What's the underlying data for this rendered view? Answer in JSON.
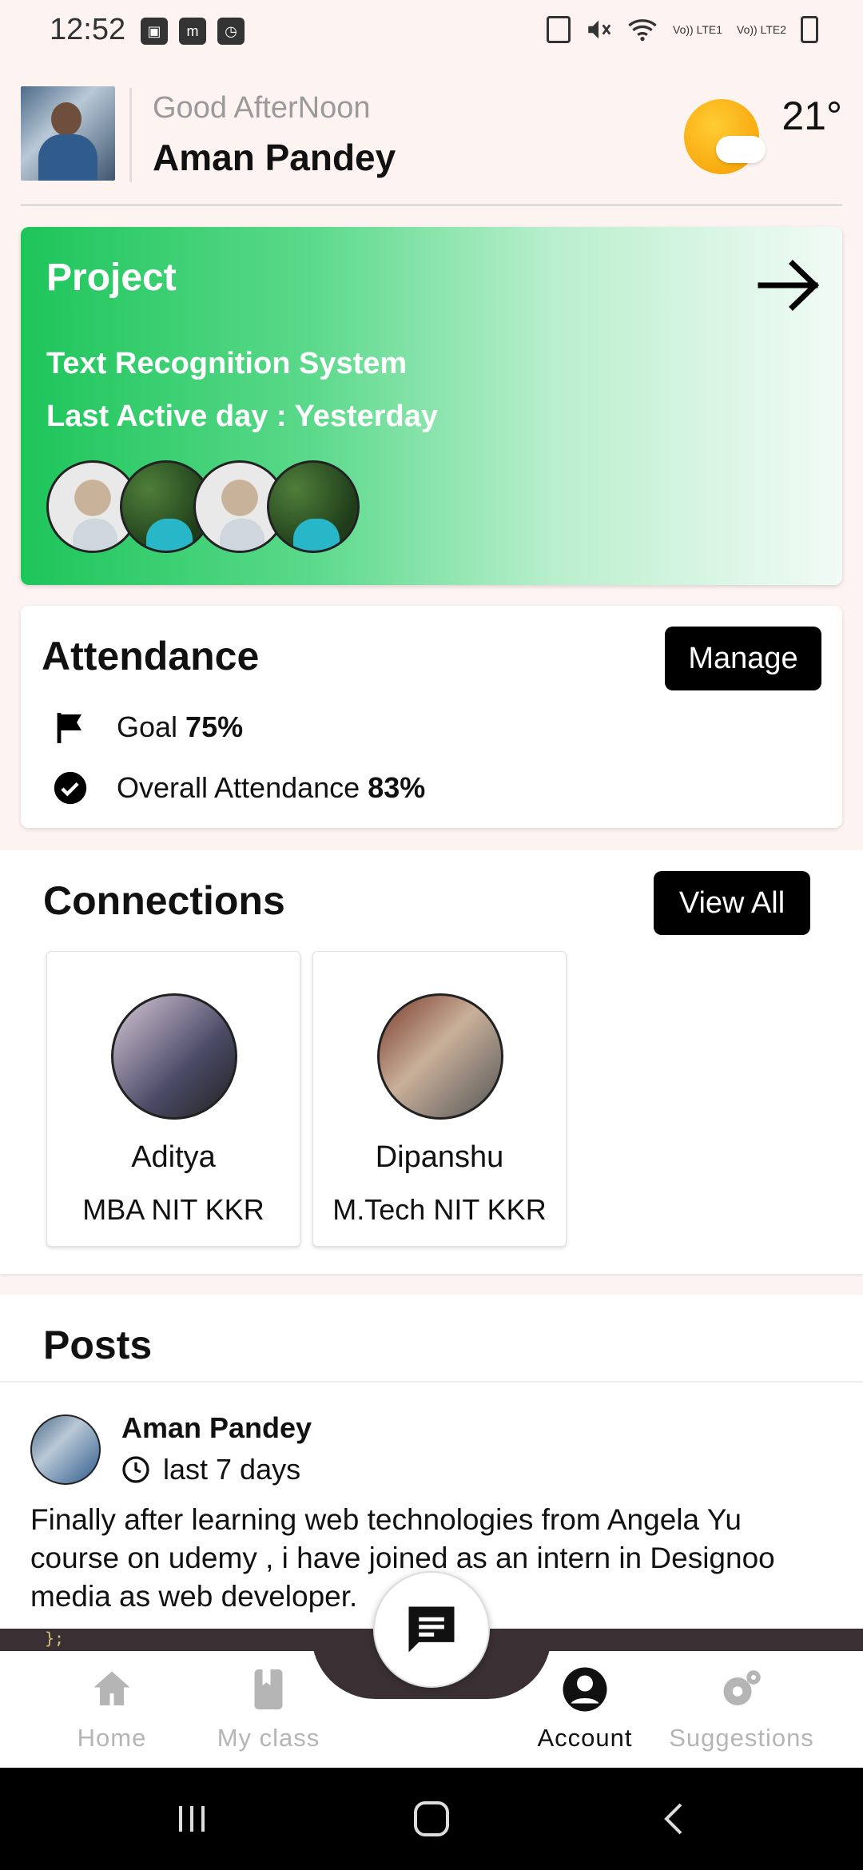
{
  "status_bar": {
    "time": "12:52",
    "left_icons": [
      "image-icon",
      "my-app-icon",
      "clock-app-icon"
    ],
    "right_icons": [
      "nfc-icon",
      "mute-icon",
      "wifi-icon",
      "lte1-signal-icon",
      "lte2-signal-icon",
      "battery-icon"
    ],
    "lte1_label": "Vo)) LTE1",
    "lte2_label": "Vo)) LTE2"
  },
  "header": {
    "greeting": "Good AfterNoon",
    "user_name": "Aman Pandey",
    "temperature": "21°",
    "weather_icon": "sun-cloud-icon"
  },
  "project": {
    "title": "Project",
    "name": "Text Recognition System",
    "last_active": "Last Active day : Yesterday",
    "member_count": 4
  },
  "attendance": {
    "title": "Attendance",
    "manage_label": "Manage",
    "goal_label": "Goal",
    "goal_value": "75%",
    "overall_label": "Overall Attendance",
    "overall_value": "83%"
  },
  "connections": {
    "title": "Connections",
    "view_all_label": "View All",
    "items": [
      {
        "name": "Aditya",
        "subtitle": "MBA NIT KKR"
      },
      {
        "name": "Dipanshu",
        "subtitle": "M.Tech NIT KKR"
      }
    ]
  },
  "posts": {
    "title": "Posts",
    "items": [
      {
        "author": "Aman Pandey",
        "time": "last 7 days",
        "text": "Finally after learning web technologies from Angela Yu course on udemy , i have joined as an intern in Designoo media as web developer.",
        "image_snippet": "};"
      }
    ]
  },
  "bottom_nav": {
    "items": [
      {
        "label": "Home",
        "icon": "home-icon",
        "active": false
      },
      {
        "label": "My class",
        "icon": "book-icon",
        "active": false
      },
      {
        "label": "Account",
        "icon": "account-icon",
        "active": true
      },
      {
        "label": "Suggestions",
        "icon": "gear-icon",
        "active": false
      }
    ],
    "fab_icon": "chat-icon"
  },
  "colors": {
    "project_gradient_start": "#1dc55a",
    "project_gradient_end": "#f2fbf6",
    "button_bg": "#000000",
    "background": "#fdf4f2",
    "inactive_nav": "#b5b5b5"
  }
}
